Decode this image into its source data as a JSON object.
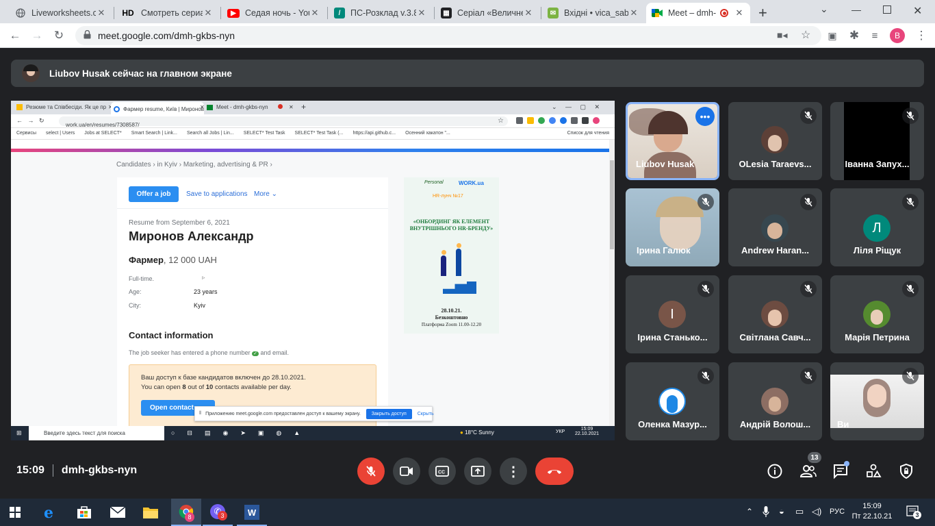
{
  "browser": {
    "tabs": [
      {
        "label": "Liveworksheets.co",
        "icon": "globe-icon"
      },
      {
        "label": "Смотреть сериал",
        "icon": "hd-icon"
      },
      {
        "label": "Седая ночь - You",
        "icon": "youtube-icon"
      },
      {
        "label": "ПС-Розклад v.3.8",
        "icon": "schedule-icon"
      },
      {
        "label": "Серіал «Величне",
        "icon": "film-icon"
      },
      {
        "label": "Вхідні • vica_sab",
        "icon": "mail-icon"
      },
      {
        "label": "Meet – dmh-",
        "icon": "meet-icon"
      }
    ],
    "url": "meet.google.com/dmh-gkbs-nyn",
    "profile_letter": "B",
    "new_tab": "+"
  },
  "banner": {
    "text": "Liubov Husak сейчас на главном экране"
  },
  "shared": {
    "tabs": [
      "Резюме та Співбесіди. Як це пр",
      "Фармер resume, Київ | Миронов",
      "Meet - dmh-gkbs-nyn"
    ],
    "url": "work.ua/en/resumes/7308587/",
    "bookmarks": [
      "Сервисы",
      "select | Users",
      "Jobs at SELECT*",
      "Smart Search | Link...",
      "Search all Jobs | Lin...",
      "SELECT* Test Task",
      "SELECT* Test Task (...",
      "https://api.github.c...",
      "Осенний хакатон \"...",
      "Список для чтения"
    ],
    "breadcrumb": "Candidates › in Kyiv › Marketing, advertising & PR ›",
    "offer_btn": "Offer a job",
    "save_link": "Save to applications",
    "more_link": "More",
    "resume_date": "Resume from September 6, 2021",
    "name": "Миронов Александр",
    "position": "Фармер",
    "salary": ", 12 000 UAH",
    "fields": [
      {
        "label": "Full-time.",
        "value": ""
      },
      {
        "label": "Age:",
        "value": "23 years"
      },
      {
        "label": "City:",
        "value": "Kyiv"
      }
    ],
    "contact_title": "Contact information",
    "contact_text": "The job seeker has entered a phone number",
    "contact_text2": "and email.",
    "notice1": "Ваш доступ к базе кандидатов включен до 28.10.2021.",
    "notice2_pre": "You can open",
    "notice2_n1": "8",
    "notice2_mid": "out of",
    "notice2_n2": "10",
    "notice2_post": "contacts available per day.",
    "open_contact": "Open contact",
    "share_notice": "Приложению meet.google.com предоставлен доступ к вашему экрану.",
    "share_stop": "Закрыть доступ",
    "share_hide": "Скрыть",
    "ad": {
      "logo1": "Personal",
      "logo2": "WORK.ua",
      "tag": "HR-лунч №17",
      "headline": "«ОНБОРДИНГ ЯК ЕЛЕМЕНТ ВНУТРІШНЬОГО HR-БРЕНДУ»",
      "date": "28.10.21.",
      "free": "Безкоштовно",
      "platform": "Платформа Zoom 11.00-12.20"
    },
    "taskbar": {
      "search": "Введите здесь текст для поиска",
      "weather": "18°C  Sunny",
      "lang": "УКР",
      "time": "15:09",
      "date": "22.10.2021"
    }
  },
  "participants": [
    {
      "name": "Liubov Husak",
      "initial": "",
      "color": "#8d6e63",
      "video": true,
      "muted": false,
      "speaking": true
    },
    {
      "name": "OLesia Taraevs...",
      "initial": "",
      "color": "#5d4037",
      "video": false,
      "muted": true
    },
    {
      "name": "Іванна Запух...",
      "initial": "",
      "color": "#000000",
      "video": false,
      "muted": true
    },
    {
      "name": "Ірина Галюк",
      "initial": "",
      "color": "#9fb8c8",
      "video": true,
      "muted": true
    },
    {
      "name": "Andrew Haran...",
      "initial": "",
      "color": "#6d4c41",
      "video": false,
      "muted": true
    },
    {
      "name": "Ліля Ріщук",
      "initial": "Л",
      "color": "#00897b",
      "video": false,
      "muted": true
    },
    {
      "name": "Ірина Станько...",
      "initial": "І",
      "color": "#795548",
      "video": false,
      "muted": true
    },
    {
      "name": "Світлана Савч...",
      "initial": "",
      "color": "#6d4c41",
      "video": false,
      "muted": true
    },
    {
      "name": "Марія Петрина",
      "initial": "",
      "color": "#7cb342",
      "video": false,
      "muted": true
    },
    {
      "name": "Оленка Мазур...",
      "initial": "",
      "color": "#1e88e5",
      "video": false,
      "muted": true
    },
    {
      "name": "Андрій Волош...",
      "initial": "",
      "color": "#8d6e63",
      "video": false,
      "muted": true
    },
    {
      "name": "Ви",
      "initial": "",
      "color": "#e0e0e0",
      "video": true,
      "muted": true
    }
  ],
  "meeting": {
    "time": "15:09",
    "code": "dmh-gkbs-nyn",
    "people_count": "13"
  },
  "taskbar": {
    "lang": "РУС",
    "time": "15:09",
    "date": "Пт 22.10.21",
    "notifications": "3",
    "chrome_badge": "8",
    "viber_badge": "3"
  },
  "colors": {
    "meet_bg": "#202124",
    "tile": "#3c4043",
    "end_call": "#ea4335",
    "accent": "#1a73e8",
    "speaking": "#8ab4f8"
  }
}
